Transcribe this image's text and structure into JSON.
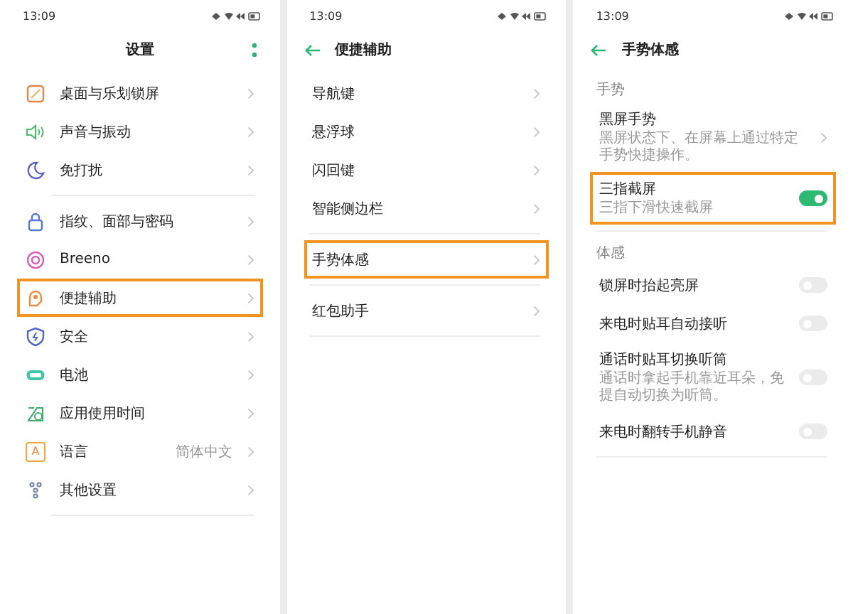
{
  "panels": [
    {
      "time": "13:09",
      "header": {
        "title": "设置",
        "menu": true
      },
      "with_icons": true,
      "groups": [
        {
          "items": [
            {
              "kind": "link",
              "label": "桌面与乐划锁屏",
              "highlighted": false
            },
            {
              "kind": "link",
              "label": "声音与振动",
              "highlighted": false
            },
            {
              "kind": "link",
              "label": "免打扰",
              "highlighted": false
            }
          ]
        },
        {
          "items": [
            {
              "kind": "link",
              "label": "指纹、面部与密码",
              "highlighted": false
            },
            {
              "kind": "link",
              "label": "Breeno",
              "highlighted": false
            },
            {
              "kind": "link",
              "label": "便捷辅助",
              "highlighted": true
            },
            {
              "kind": "link",
              "label": "安全",
              "highlighted": false
            },
            {
              "kind": "link",
              "label": "电池",
              "highlighted": false
            },
            {
              "kind": "link",
              "label": "应用使用时间",
              "highlighted": false
            },
            {
              "kind": "link",
              "label": "语言",
              "value": "简体中文",
              "icon_letter": "A",
              "highlighted": false
            },
            {
              "kind": "link",
              "label": "其他设置",
              "highlighted": false
            }
          ]
        }
      ]
    },
    {
      "time": "13:09",
      "header": {
        "title": "便捷辅助",
        "back": true
      },
      "groups": [
        {
          "items": [
            {
              "kind": "link",
              "label": "导航键",
              "highlighted": false
            },
            {
              "kind": "link",
              "label": "悬浮球",
              "highlighted": false
            },
            {
              "kind": "link",
              "label": "闪回键",
              "highlighted": false
            },
            {
              "kind": "link",
              "label": "智能侧边栏",
              "highlighted": false
            }
          ]
        },
        {
          "items": [
            {
              "kind": "link",
              "label": "手势体感",
              "highlighted": true
            }
          ]
        },
        {
          "items": [
            {
              "kind": "link",
              "label": "红包助手",
              "highlighted": false
            }
          ]
        }
      ]
    },
    {
      "time": "13:09",
      "header": {
        "title": "手势体感",
        "back": true
      },
      "groups": [
        {
          "heading": "手势",
          "items": [
            {
              "kind": "link",
              "label": "黑屏手势",
              "sub": "黑屏状态下、在屏幕上通过特定手势快捷操作。",
              "highlighted": false
            },
            {
              "kind": "toggle",
              "label": "三指截屏",
              "sub": "三指下滑快速截屏",
              "on": true,
              "highlighted": true
            }
          ]
        },
        {
          "heading": "体感",
          "items": [
            {
              "kind": "toggle",
              "label": "锁屏时抬起亮屏",
              "on": false,
              "highlighted": false
            },
            {
              "kind": "toggle",
              "label": "来电时贴耳自动接听",
              "on": false,
              "highlighted": false
            },
            {
              "kind": "toggle",
              "label": "通话时贴耳切换听筒",
              "sub": "通话时拿起手机靠近耳朵，免提自动切换为听筒。",
              "on": false,
              "highlighted": false
            },
            {
              "kind": "toggle",
              "label": "来电时翻转手机静音",
              "on": false,
              "highlighted": false
            }
          ]
        }
      ]
    }
  ]
}
